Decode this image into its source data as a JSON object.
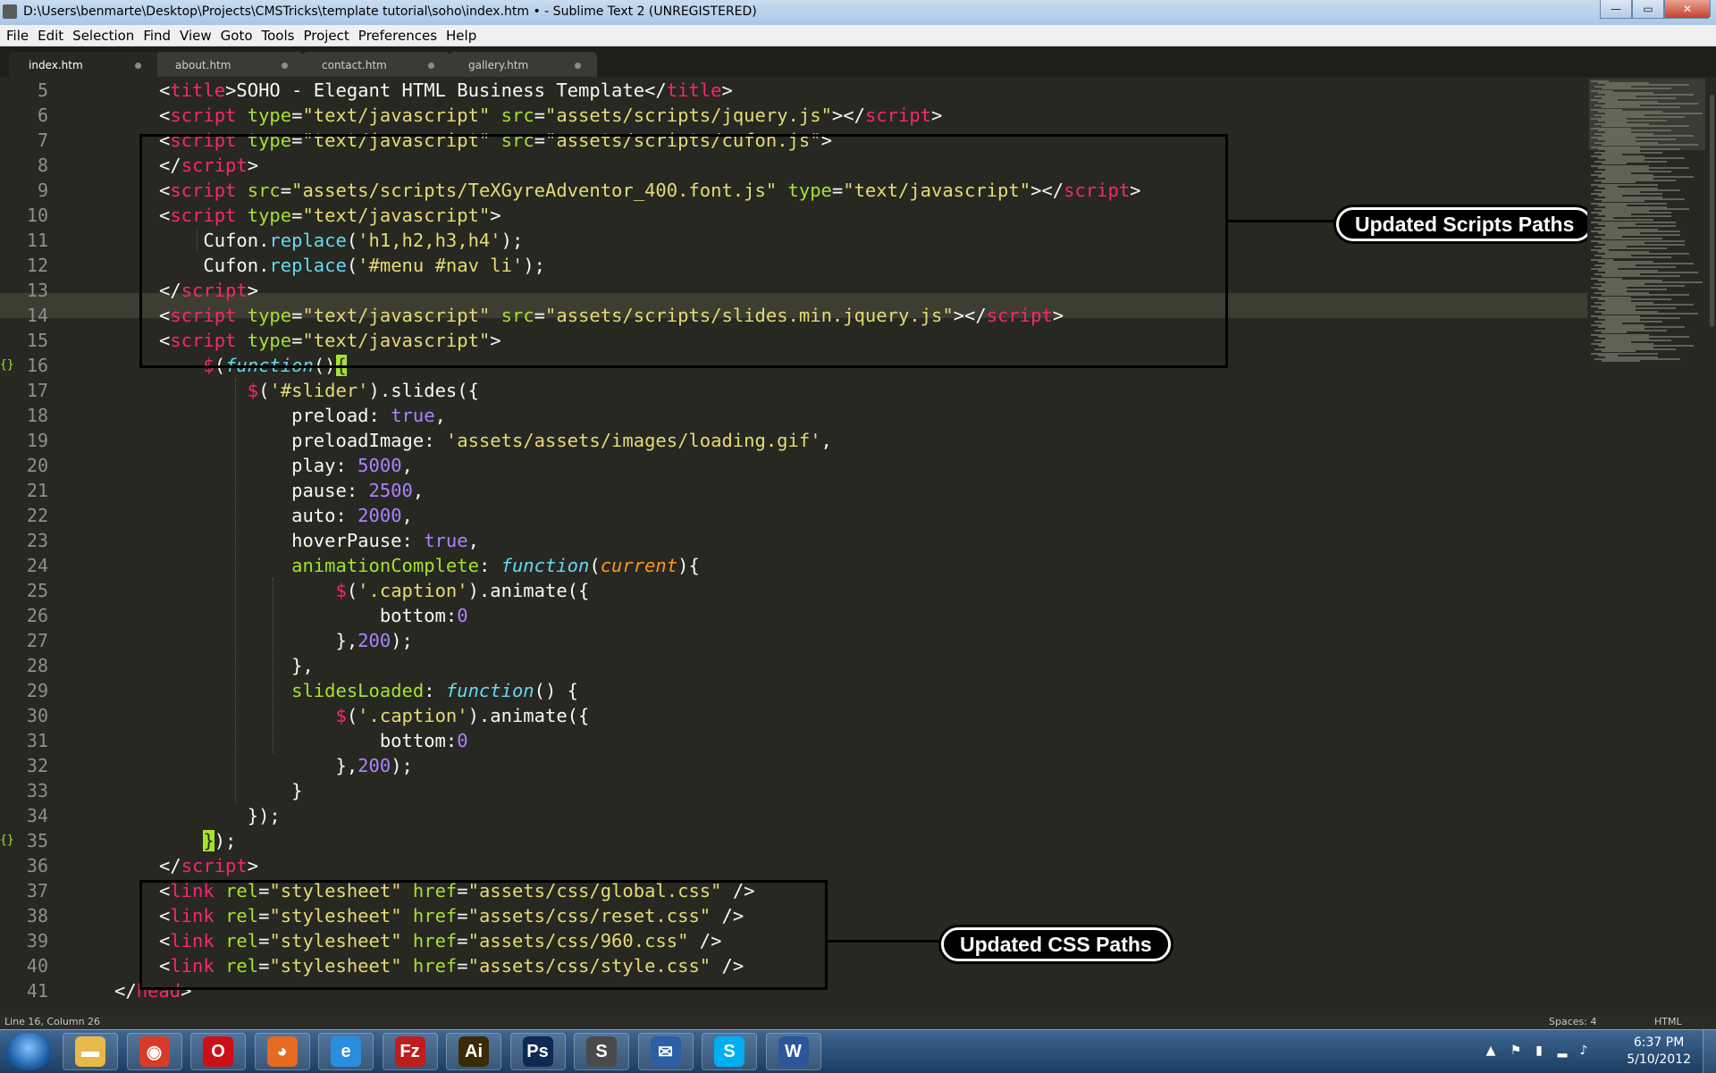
{
  "window": {
    "title": "D:\\Users\\benmarte\\Desktop\\Projects\\CMSTricks\\template tutorial\\soho\\index.htm • - Sublime Text 2 (UNREGISTERED)",
    "minimize": "—",
    "maximize": "▭",
    "close": "✕"
  },
  "menu": [
    "File",
    "Edit",
    "Selection",
    "Find",
    "View",
    "Goto",
    "Tools",
    "Project",
    "Preferences",
    "Help"
  ],
  "tabs": [
    "index.htm",
    "about.htm",
    "contact.htm",
    "gallery.htm"
  ],
  "editor": {
    "line_numbers": [
      "5",
      "6",
      "7",
      "8",
      "9",
      "10",
      "11",
      "12",
      "13",
      "14",
      "15",
      "16",
      "17",
      "18",
      "19",
      "20",
      "21",
      "22",
      "23",
      "24",
      "25",
      "26",
      "27",
      "28",
      "29",
      "30",
      "31",
      "32",
      "33",
      "34",
      "35",
      "36",
      "37",
      "38",
      "39",
      "40",
      "41"
    ],
    "fold_marker": "{}",
    "lines": [
      [
        [
          "t",
          "<"
        ],
        [
          "tag",
          "title"
        ],
        [
          "t",
          ">SOHO - Elegant HTML Business Template</"
        ],
        [
          "tag",
          "title"
        ],
        [
          "t",
          ">"
        ]
      ],
      [
        [
          "t",
          "<"
        ],
        [
          "tag",
          "script"
        ],
        [
          "t",
          " "
        ],
        [
          "attr",
          "type"
        ],
        [
          "t",
          "="
        ],
        [
          "str",
          "\"text/javascript\""
        ],
        [
          "t",
          " "
        ],
        [
          "attr",
          "src"
        ],
        [
          "t",
          "="
        ],
        [
          "str",
          "\"assets/scripts/jquery.js\""
        ],
        [
          "t",
          "></"
        ],
        [
          "tag",
          "script"
        ],
        [
          "t",
          ">"
        ]
      ],
      [
        [
          "t",
          "<"
        ],
        [
          "tag",
          "script"
        ],
        [
          "t",
          " "
        ],
        [
          "attr",
          "type"
        ],
        [
          "t",
          "="
        ],
        [
          "str",
          "\"text/javascript\""
        ],
        [
          "t",
          " "
        ],
        [
          "attr",
          "src"
        ],
        [
          "t",
          "="
        ],
        [
          "str",
          "\"assets/scripts/cufon.js\""
        ],
        [
          "t",
          ">"
        ]
      ],
      [
        [
          "t",
          "</"
        ],
        [
          "tag",
          "script"
        ],
        [
          "t",
          ">"
        ]
      ],
      [
        [
          "t",
          "<"
        ],
        [
          "tag",
          "script"
        ],
        [
          "t",
          " "
        ],
        [
          "attr",
          "src"
        ],
        [
          "t",
          "="
        ],
        [
          "str",
          "\"assets/scripts/TeXGyreAdventor_400.font.js\""
        ],
        [
          "t",
          " "
        ],
        [
          "attr",
          "type"
        ],
        [
          "t",
          "="
        ],
        [
          "str",
          "\"text/javascript\""
        ],
        [
          "t",
          "></"
        ],
        [
          "tag",
          "script"
        ],
        [
          "t",
          ">"
        ]
      ],
      [
        [
          "t",
          "<"
        ],
        [
          "tag",
          "script"
        ],
        [
          "t",
          " "
        ],
        [
          "attr",
          "type"
        ],
        [
          "t",
          "="
        ],
        [
          "str",
          "\"text/javascript\""
        ],
        [
          "t",
          ">"
        ]
      ],
      [
        [
          "t",
          "    Cufon."
        ],
        [
          "call",
          "replace"
        ],
        [
          "t",
          "("
        ],
        [
          "str",
          "'h1,h2,h3,h4'"
        ],
        [
          "t",
          ");"
        ]
      ],
      [
        [
          "t",
          "    Cufon."
        ],
        [
          "call",
          "replace"
        ],
        [
          "t",
          "("
        ],
        [
          "str",
          "'#menu #nav li'"
        ],
        [
          "t",
          ");"
        ]
      ],
      [
        [
          "t",
          "</"
        ],
        [
          "tag",
          "script"
        ],
        [
          "t",
          ">"
        ]
      ],
      [
        [
          "t",
          "<"
        ],
        [
          "tag",
          "script"
        ],
        [
          "t",
          " "
        ],
        [
          "attr",
          "type"
        ],
        [
          "t",
          "="
        ],
        [
          "str",
          "\"text/javascript\""
        ],
        [
          "t",
          " "
        ],
        [
          "attr",
          "src"
        ],
        [
          "t",
          "="
        ],
        [
          "str",
          "\"assets/scripts/slides.min.jquery.js\""
        ],
        [
          "t",
          "></"
        ],
        [
          "tag",
          "script"
        ],
        [
          "t",
          ">"
        ]
      ],
      [
        [
          "t",
          "<"
        ],
        [
          "tag",
          "script"
        ],
        [
          "t",
          " "
        ],
        [
          "attr",
          "type"
        ],
        [
          "t",
          "="
        ],
        [
          "str",
          "\"text/javascript\""
        ],
        [
          "t",
          ">"
        ]
      ],
      [
        [
          "t",
          "    "
        ],
        [
          "tag",
          "$"
        ],
        [
          "t",
          "("
        ],
        [
          "fn",
          "function"
        ],
        [
          "t",
          "()"
        ],
        [
          "hl",
          "{"
        ]
      ],
      [
        [
          "t",
          "        "
        ],
        [
          "tag",
          "$"
        ],
        [
          "t",
          "("
        ],
        [
          "str",
          "'#slider'"
        ],
        [
          "t",
          ").slides({"
        ]
      ],
      [
        [
          "t",
          "            preload: "
        ],
        [
          "num",
          "true"
        ],
        [
          "t",
          ","
        ]
      ],
      [
        [
          "t",
          "            preloadImage: "
        ],
        [
          "str",
          "'assets/assets/images/loading.gif'"
        ],
        [
          "t",
          ","
        ]
      ],
      [
        [
          "t",
          "            play: "
        ],
        [
          "num",
          "5000"
        ],
        [
          "t",
          ","
        ]
      ],
      [
        [
          "t",
          "            pause: "
        ],
        [
          "num",
          "2500"
        ],
        [
          "t",
          ","
        ]
      ],
      [
        [
          "t",
          "            auto: "
        ],
        [
          "num",
          "2000"
        ],
        [
          "t",
          ","
        ]
      ],
      [
        [
          "t",
          "            hoverPause: "
        ],
        [
          "num",
          "true"
        ],
        [
          "t",
          ","
        ]
      ],
      [
        [
          "t",
          "            "
        ],
        [
          "attr",
          "animationComplete"
        ],
        [
          "t",
          ": "
        ],
        [
          "fn",
          "function"
        ],
        [
          "t",
          "("
        ],
        [
          "param",
          "current"
        ],
        [
          "t",
          "){"
        ]
      ],
      [
        [
          "t",
          "                "
        ],
        [
          "tag",
          "$"
        ],
        [
          "t",
          "("
        ],
        [
          "str",
          "'.caption'"
        ],
        [
          "t",
          ").animate({"
        ]
      ],
      [
        [
          "t",
          "                    bottom:"
        ],
        [
          "num",
          "0"
        ]
      ],
      [
        [
          "t",
          "                },"
        ],
        [
          "num",
          "200"
        ],
        [
          "t",
          ");"
        ]
      ],
      [
        [
          "t",
          "            },"
        ]
      ],
      [
        [
          "t",
          "            "
        ],
        [
          "attr",
          "slidesLoaded"
        ],
        [
          "t",
          ": "
        ],
        [
          "fn",
          "function"
        ],
        [
          "t",
          "() {"
        ]
      ],
      [
        [
          "t",
          "                "
        ],
        [
          "tag",
          "$"
        ],
        [
          "t",
          "("
        ],
        [
          "str",
          "'.caption'"
        ],
        [
          "t",
          ").animate({"
        ]
      ],
      [
        [
          "t",
          "                    bottom:"
        ],
        [
          "num",
          "0"
        ]
      ],
      [
        [
          "t",
          "                },"
        ],
        [
          "num",
          "200"
        ],
        [
          "t",
          ");"
        ]
      ],
      [
        [
          "t",
          "            }"
        ]
      ],
      [
        [
          "t",
          "        });"
        ]
      ],
      [
        [
          "t",
          "    "
        ],
        [
          "hl",
          "}"
        ],
        [
          "t",
          ");"
        ]
      ],
      [
        [
          "t",
          "</"
        ],
        [
          "tag",
          "script"
        ],
        [
          "t",
          ">"
        ]
      ],
      [
        [
          "t",
          "<"
        ],
        [
          "tag",
          "link"
        ],
        [
          "t",
          " "
        ],
        [
          "attr",
          "rel"
        ],
        [
          "t",
          "="
        ],
        [
          "str",
          "\"stylesheet\""
        ],
        [
          "t",
          " "
        ],
        [
          "attr",
          "href"
        ],
        [
          "t",
          "="
        ],
        [
          "str",
          "\"assets/css/global.css\""
        ],
        [
          "t",
          " />"
        ]
      ],
      [
        [
          "t",
          "<"
        ],
        [
          "tag",
          "link"
        ],
        [
          "t",
          " "
        ],
        [
          "attr",
          "rel"
        ],
        [
          "t",
          "="
        ],
        [
          "str",
          "\"stylesheet\""
        ],
        [
          "t",
          " "
        ],
        [
          "attr",
          "href"
        ],
        [
          "t",
          "="
        ],
        [
          "str",
          "\"assets/css/reset.css\""
        ],
        [
          "t",
          " />"
        ]
      ],
      [
        [
          "t",
          "<"
        ],
        [
          "tag",
          "link"
        ],
        [
          "t",
          " "
        ],
        [
          "attr",
          "rel"
        ],
        [
          "t",
          "="
        ],
        [
          "str",
          "\"stylesheet\""
        ],
        [
          "t",
          " "
        ],
        [
          "attr",
          "href"
        ],
        [
          "t",
          "="
        ],
        [
          "str",
          "\"assets/css/960.css\""
        ],
        [
          "t",
          " />"
        ]
      ],
      [
        [
          "t",
          "<"
        ],
        [
          "tag",
          "link"
        ],
        [
          "t",
          " "
        ],
        [
          "attr",
          "rel"
        ],
        [
          "t",
          "="
        ],
        [
          "str",
          "\"stylesheet\""
        ],
        [
          "t",
          " "
        ],
        [
          "attr",
          "href"
        ],
        [
          "t",
          "="
        ],
        [
          "str",
          "\"assets/css/style.css\""
        ],
        [
          "t",
          " />"
        ]
      ],
      [
        [
          "t",
          "</"
        ],
        [
          "tag",
          "head"
        ],
        [
          "t",
          ">"
        ]
      ]
    ]
  },
  "annotations": {
    "scripts_label": "Updated Scripts Paths",
    "css_label": "Updated CSS Paths"
  },
  "status": {
    "position": "Line 16, Column 26",
    "spaces": "Spaces: 4",
    "syntax": "HTML"
  },
  "taskbar": {
    "apps": [
      {
        "name": "explorer-icon",
        "glyph": "▬",
        "color": "#e8b94a"
      },
      {
        "name": "chrome-icon",
        "glyph": "◉",
        "color": "#d83b2a"
      },
      {
        "name": "opera-icon",
        "glyph": "O",
        "color": "#cc0f16"
      },
      {
        "name": "firefox-icon",
        "glyph": "◕",
        "color": "#e66a1f"
      },
      {
        "name": "internet-explorer-icon",
        "glyph": "e",
        "color": "#2a8de0"
      },
      {
        "name": "filezilla-icon",
        "glyph": "Fz",
        "color": "#bf1e1e"
      },
      {
        "name": "illustrator-icon",
        "glyph": "Ai",
        "color": "#3b2a06"
      },
      {
        "name": "photoshop-icon",
        "glyph": "Ps",
        "color": "#0f2a52"
      },
      {
        "name": "sublime-text-icon",
        "glyph": "S",
        "color": "#4a4a4a"
      },
      {
        "name": "thunderbird-icon",
        "glyph": "✉",
        "color": "#2c5fa3"
      },
      {
        "name": "skype-icon",
        "glyph": "S",
        "color": "#00aff0"
      },
      {
        "name": "word-icon",
        "glyph": "W",
        "color": "#2b579a"
      }
    ],
    "clock_time": "6:37 PM",
    "clock_date": "5/10/2012"
  }
}
